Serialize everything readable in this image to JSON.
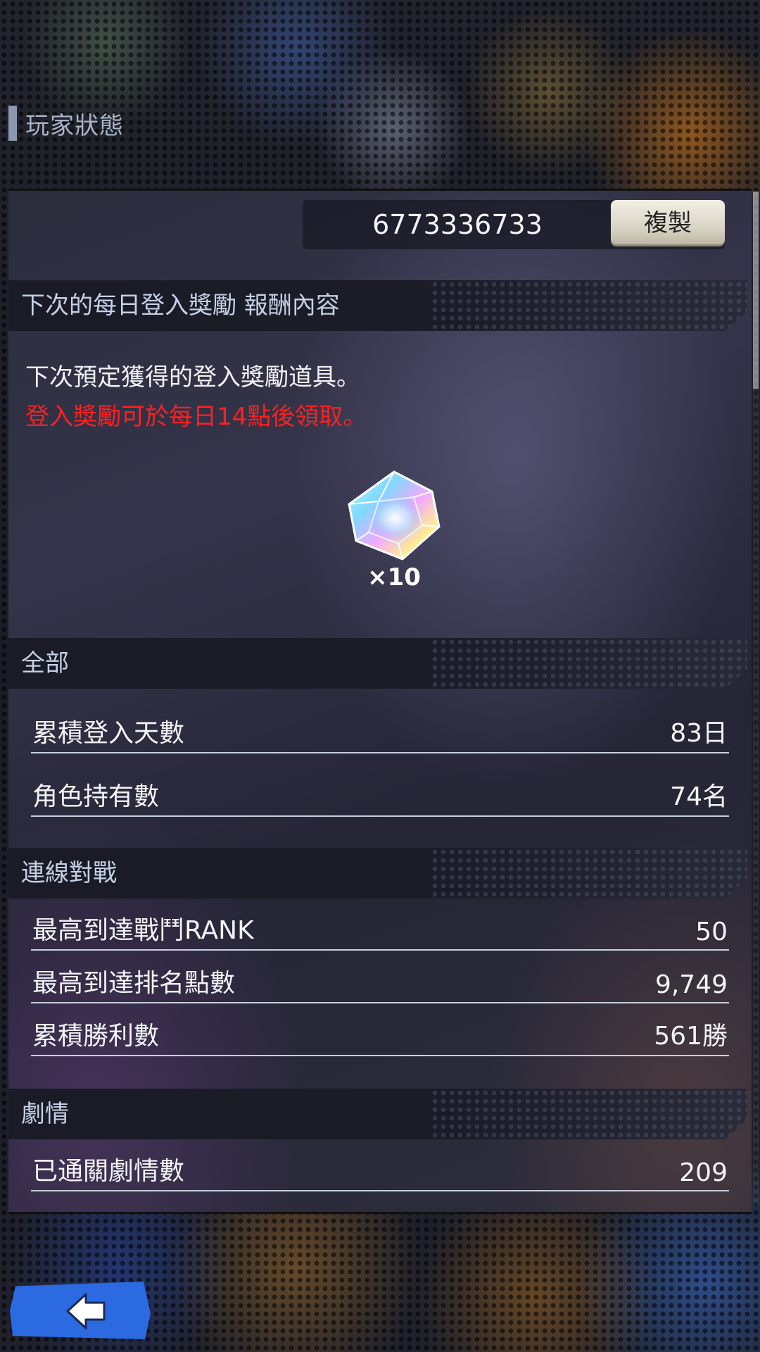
{
  "header": {
    "title": "玩家狀態"
  },
  "player": {
    "id": "6773336733",
    "copy_label": "複製"
  },
  "login_bonus": {
    "section_title": "下次的每日登入獎勵 報酬內容",
    "description": "下次預定獲得的登入獎勵道具。",
    "notice": "登入獎勵可於每日14點後領取。",
    "item_icon": "rainbow-gem-icon",
    "item_count": "×10"
  },
  "overall": {
    "section_title": "全部",
    "rows": [
      {
        "label": "累積登入天數",
        "value": "83日"
      },
      {
        "label": "角色持有數",
        "value": "74名"
      }
    ]
  },
  "online_battle": {
    "section_title": "連線對戰",
    "rows": [
      {
        "label": "最高到達戰鬥RANK",
        "value": "50"
      },
      {
        "label": "最高到達排名點數",
        "value": "9,749"
      },
      {
        "label": "累積勝利數",
        "value": "561勝"
      }
    ]
  },
  "story": {
    "section_title": "劇情",
    "rows": [
      {
        "label": "已通關劇情數",
        "value": "209"
      }
    ]
  },
  "colors": {
    "notice_red": "#ff2020",
    "back_button_blue": "#2b6ae0"
  },
  "back_button": {
    "icon": "back-arrow-icon"
  }
}
